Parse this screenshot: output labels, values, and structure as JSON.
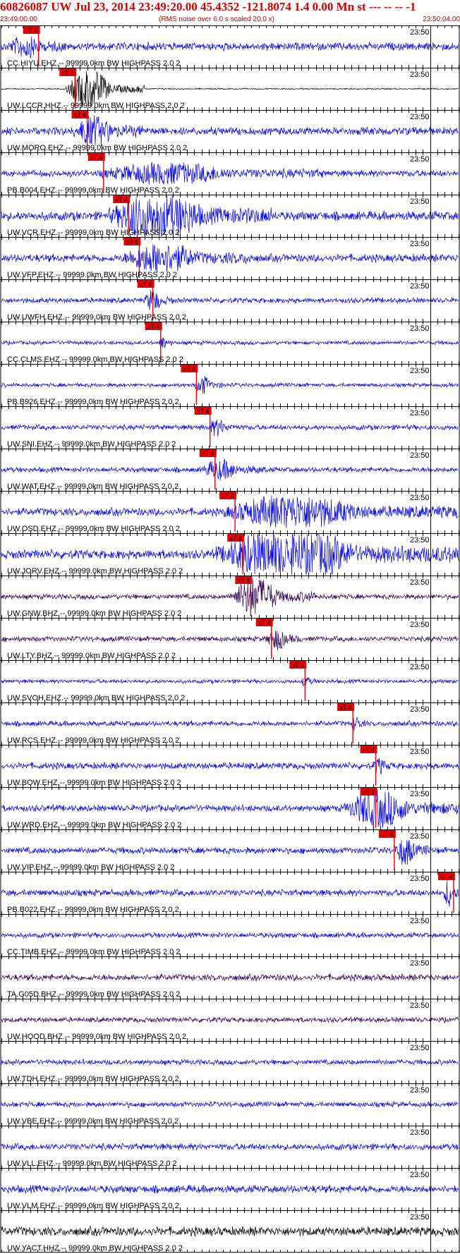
{
  "header": {
    "title": "60826087 UW Jul 23, 2014 23:49:20.00   45.4352 -121.8074  1.4 0.00 Mn st --- -- --   -1",
    "start_time": "23:49:00.00",
    "rms_note": "(RMS noise over 6.0 s scaled 20.0 x)",
    "end_time": "23:50:04.00"
  },
  "colors": {
    "blue_trace": "#0000ee",
    "black_trace": "#000000",
    "purple_trace": "#2a0050",
    "pick": "#ee0000",
    "header_text": "#d40000",
    "grid": "#000000"
  },
  "chart_data": {
    "type": "line",
    "title": "60826087 UW Jul 23, 2014 23:49:20.00   45.4352 -121.8074  1.4 0.00 Mn st --- -- --   -1",
    "x_start": "23:49:00.00",
    "x_end": "23:50:04.00",
    "x_range_seconds": [
      0,
      64
    ],
    "tick_interval_seconds": 1,
    "minute_mark_label": "23:50",
    "pick_label": "xT 4",
    "series": [
      {
        "label": "CC.HIYU.EHZ.-- 99999.0km BW  HIGHPASS  2.0  2",
        "color": "blue",
        "pick_s": 5.2,
        "burst": [
          1,
          9,
          0.6
        ],
        "noise": 0.3
      },
      {
        "label": "UW.LCCR.HHZ.-- 99999.0km BW  HIGHPASS  2.0  2",
        "color": "black",
        "pick_s": 10.3,
        "burst": [
          9,
          20,
          1.4
        ],
        "noise": 0.05
      },
      {
        "label": "UW.MORO.EHZ.-- 99999.0km BW  HIGHPASS  2.0  2",
        "color": "blue",
        "pick_s": 12.0,
        "burst": [
          10,
          20,
          0.9
        ],
        "noise": 0.3
      },
      {
        "label": "PB.B004.EHZ.-- 99999.0km BW  HIGHPASS  2.0  2",
        "color": "blue",
        "pick_s": 14.3,
        "burst": [
          14,
          45,
          0.6
        ],
        "noise": 0.25
      },
      {
        "label": "UW.VCR.EHZ.-- 99999.0km BW  HIGHPASS  2.0  2",
        "color": "blue",
        "pick_s": 17.8,
        "burst": [
          15,
          38,
          1.6
        ],
        "noise": 0.35
      },
      {
        "label": "UW.VFP.EHZ.-- 99999.0km BW  HIGHPASS  2.0  2",
        "color": "blue",
        "pick_s": 19.3,
        "burst": [
          17,
          35,
          0.9
        ],
        "noise": 0.3
      },
      {
        "label": "UW.UWFH.EHZ.-- 99999.0km BW  HIGHPASS  2.0  2",
        "color": "blue",
        "pick_s": 21.2,
        "burst": [
          20,
          24,
          0.7
        ],
        "noise": 0.2
      },
      {
        "label": "CC.CLMS.EHZ.-- 99999.0km BW  HIGHPASS  2.0  2",
        "color": "blue",
        "pick_s": 22.3,
        "burst": [
          22,
          24,
          0.4
        ],
        "noise": 0.15
      },
      {
        "label": "PB.B926.EHZ.-- 99999.0km BW  HIGHPASS  2.0  2",
        "color": "blue",
        "pick_s": 27.3,
        "burst": [
          27,
          31,
          0.6
        ],
        "noise": 0.15
      },
      {
        "label": "UW.SNI.EHZ.-- 99999.0km BW  HIGHPASS  2.0  2",
        "color": "blue",
        "pick_s": 29.2,
        "burst": [
          29,
          33,
          0.5
        ],
        "noise": 0.2
      },
      {
        "label": "UW.WAT.EHZ.-- 99999.0km BW  HIGHPASS  2.0  2",
        "color": "blue",
        "pick_s": 29.9,
        "burst": [
          28,
          37,
          0.6
        ],
        "noise": 0.2
      },
      {
        "label": "UW.OSD.EHZ.-- 99999.0km BW  HIGHPASS  2.0  2",
        "color": "blue",
        "pick_s": 32.7,
        "burst": [
          31,
          64,
          1.0
        ],
        "noise": 0.3
      },
      {
        "label": "UW.JORV.EHZ.-- 99999.0km BW  HIGHPASS  2.0  2",
        "color": "blue",
        "pick_s": 33.8,
        "burst": [
          30,
          64,
          1.7
        ],
        "noise": 0.35
      },
      {
        "label": "UW.GNW.BHZ.-- 99999.0km BW  HIGHPASS  2.0  2",
        "color": "purple",
        "pick_s": 34.9,
        "burst": [
          32,
          44,
          1.2
        ],
        "noise": 0.2
      },
      {
        "label": "UW.LTY.BHZ.-- 99999.0km BW  HIGHPASS  2.0  2",
        "color": "purple",
        "pick_s": 37.8,
        "burst": [
          37,
          42,
          0.7
        ],
        "noise": 0.2
      },
      {
        "label": "UW.SVOH.EHZ.-- 99999.0km BW  HIGHPASS  2.0  2",
        "color": "blue",
        "pick_s": 42.5,
        "burst": [
          42,
          44,
          0.4
        ],
        "noise": 0.15
      },
      {
        "label": "UW.RCS.EHZ.-- 99999.0km BW  HIGHPASS  2.0  2",
        "color": "blue",
        "pick_s": 49.2,
        "burst": [
          49,
          51,
          0.5
        ],
        "noise": 0.2
      },
      {
        "label": "UW.BOW.EHZ.-- 99999.0km BW  HIGHPASS  2.0  2",
        "color": "blue",
        "pick_s": 52.4,
        "burst": [
          52,
          55,
          0.4
        ],
        "noise": 0.25
      },
      {
        "label": "UW.WRD.EHZ.-- 99999.0km BW  HIGHPASS  2.0  2",
        "color": "blue",
        "pick_s": 52.4,
        "burst": [
          48,
          64,
          1.2
        ],
        "noise": 0.25
      },
      {
        "label": "UW.VIP.EHZ.-- 99999.0km BW  HIGHPASS  2.0  2",
        "color": "blue",
        "pick_s": 55.0,
        "burst": [
          55,
          60,
          0.9
        ],
        "noise": 0.25
      },
      {
        "label": "PB.B022.EHZ.-- 99999.0km BW  HIGHPASS  2.0  2",
        "color": "blue",
        "pick_s": 63.3,
        "burst": [
          62,
          64,
          1.0
        ],
        "noise": 0.25
      },
      {
        "label": "CC.TIMB.EHZ.-- 99999.0km BW  HIGHPASS  2.0  2",
        "color": "blue",
        "pick_s": null,
        "burst": null,
        "noise": 0.2
      },
      {
        "label": "TA.G05D.BHZ.-- 99999.0km BW  HIGHPASS  2.0  2",
        "color": "purple",
        "pick_s": null,
        "burst": null,
        "noise": 0.25
      },
      {
        "label": "UW.HOOD.BHZ.-- 99999.0km BW  HIGHPASS  2.0  2",
        "color": "purple",
        "pick_s": null,
        "burst": null,
        "noise": 0.2
      },
      {
        "label": "UW.TDH.EHZ.-- 99999.0km BW  HIGHPASS  2.0  2",
        "color": "blue",
        "pick_s": null,
        "burst": null,
        "noise": 0.2
      },
      {
        "label": "UW.VBE.EHZ.-- 99999.0km BW  HIGHPASS  2.0  2",
        "color": "blue",
        "pick_s": null,
        "burst": null,
        "noise": 0.2
      },
      {
        "label": "UW.VLL.EHZ.-- 99999.0km BW  HIGHPASS  2.0  2",
        "color": "blue",
        "pick_s": null,
        "burst": null,
        "noise": 0.25
      },
      {
        "label": "UW.VLM.EHZ.-- 99999.0km BW  HIGHPASS  2.0  2",
        "color": "blue",
        "pick_s": null,
        "burst": null,
        "noise": 0.3
      },
      {
        "label": "UW.YACT.HHZ.-- 99999.0km BW  HIGHPASS  2.0  2",
        "color": "black",
        "pick_s": null,
        "burst": null,
        "noise": 0.35
      }
    ]
  }
}
